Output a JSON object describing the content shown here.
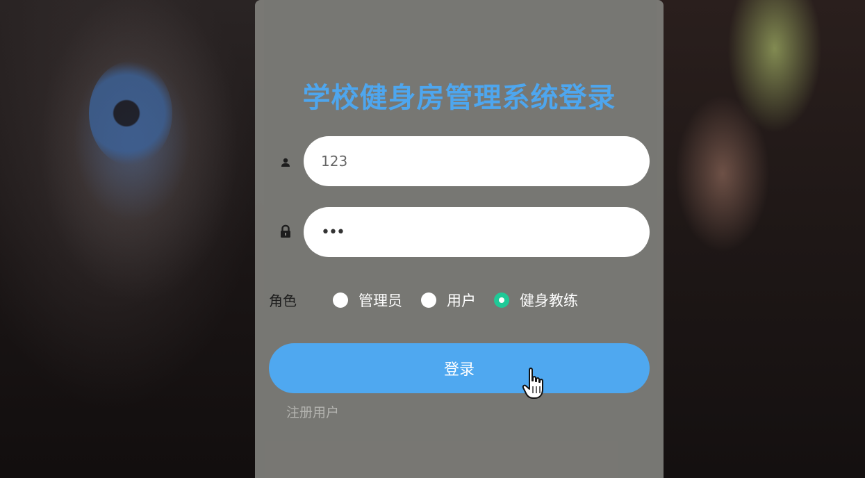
{
  "login": {
    "title": "学校健身房管理系统登录",
    "username": {
      "value": "123",
      "icon": "user-icon"
    },
    "password": {
      "value": "•••",
      "icon": "lock-icon"
    },
    "role": {
      "label": "角色",
      "options": [
        "管理员",
        "用户",
        "健身教练"
      ],
      "selected": "健身教练"
    },
    "submit_label": "登录",
    "register_link": "注册用户"
  },
  "colors": {
    "title": "#4ea6ee",
    "button": "#4fa8f0",
    "radio_checked": "#20c997"
  }
}
